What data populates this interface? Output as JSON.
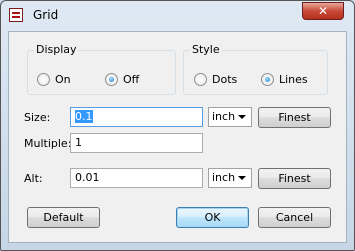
{
  "window": {
    "title": "Grid",
    "close_glyph": "✕"
  },
  "display": {
    "label": "Display",
    "on": "On",
    "off": "Off",
    "selected": "Off"
  },
  "style": {
    "label": "Style",
    "dots": "Dots",
    "lines": "Lines",
    "selected": "Lines"
  },
  "size": {
    "label": "Size:",
    "value": "0.1",
    "unit": "inch",
    "button": "Finest"
  },
  "multiple": {
    "label": "Multiple:",
    "value": "1"
  },
  "alt": {
    "label": "Alt:",
    "value": "0.01",
    "unit": "inch",
    "button": "Finest"
  },
  "buttons": {
    "default": "Default",
    "ok": "OK",
    "cancel": "Cancel"
  }
}
